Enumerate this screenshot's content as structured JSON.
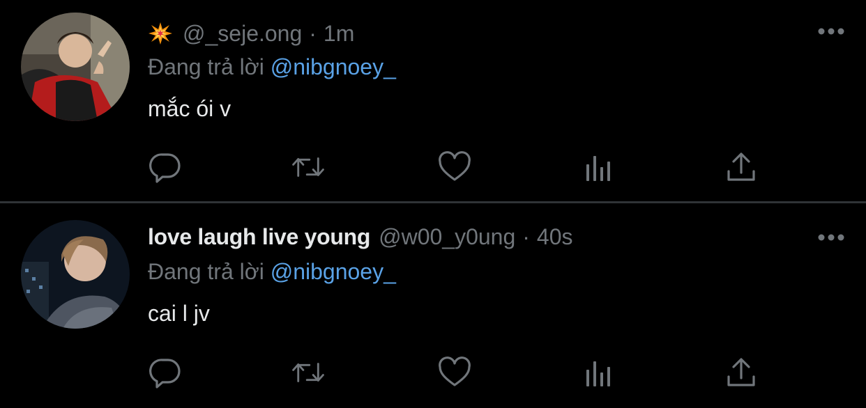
{
  "tweets": [
    {
      "display_name": "",
      "name_emoji": "collision-emoji",
      "handle": "@_seje.ong",
      "separator": "·",
      "time": "1m",
      "reply_prefix": "Đang trả lời",
      "reply_to": "@nibgnoey_",
      "text": "mắc ói v"
    },
    {
      "display_name": "love laugh live young",
      "handle": "@w00_y0ung",
      "separator": "·",
      "time": "40s",
      "reply_prefix": "Đang trả lời",
      "reply_to": "@nibgnoey_",
      "text": "cai l jv"
    }
  ],
  "colors": {
    "background": "#000000",
    "primary_text": "#e7e9ea",
    "secondary_text": "#71767b",
    "mention": "#5aa2e6",
    "divider": "#2f3336"
  },
  "icons": [
    "reply-icon",
    "retweet-icon",
    "like-icon",
    "views-icon",
    "share-icon",
    "more-icon"
  ]
}
